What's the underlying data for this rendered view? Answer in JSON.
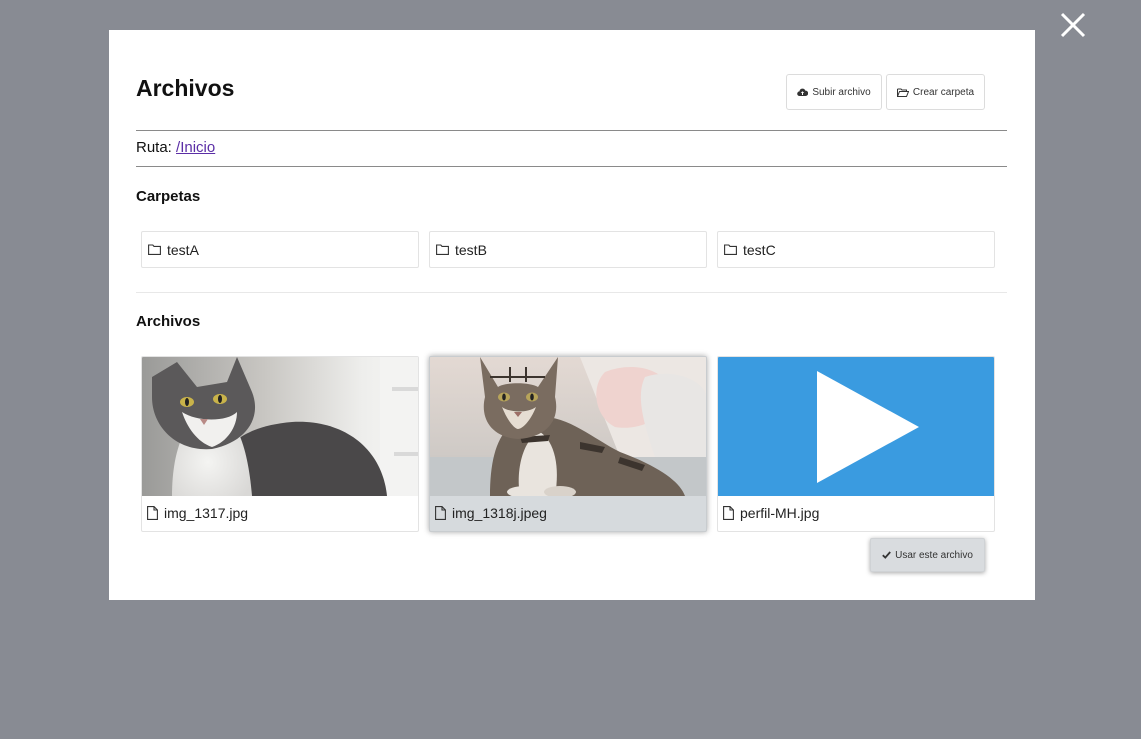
{
  "modal": {
    "title": "Archivos",
    "upload_button": "Subir archivo",
    "new_folder_button": "Crear carpeta",
    "path_label": "Ruta:",
    "path_link": "/Inicio",
    "folders_title": "Carpetas",
    "files_title": "Archivos",
    "use_button": "Usar este archivo"
  },
  "folders": [
    {
      "name": "testA",
      "icon": "folder-icon"
    },
    {
      "name": "testB",
      "icon": "folder-icon"
    },
    {
      "name": "testC",
      "icon": "folder-icon"
    }
  ],
  "files": [
    {
      "name": "img_1317.jpg",
      "thumbnail": "cat-photo-white-gray",
      "icon": "file-icon",
      "selected": false
    },
    {
      "name": "img_1318j.jpeg",
      "thumbnail": "cat-photo-tabby",
      "icon": "file-icon",
      "selected": true
    },
    {
      "name": "perfil-MH.jpg",
      "thumbnail": "video-play-placeholder",
      "icon": "file-icon",
      "selected": false
    }
  ],
  "colors": {
    "overlay": "#888b93",
    "link": "#5b2ea6",
    "video_thumb": "#3a9be0",
    "selected_card": "#d6dadd"
  }
}
